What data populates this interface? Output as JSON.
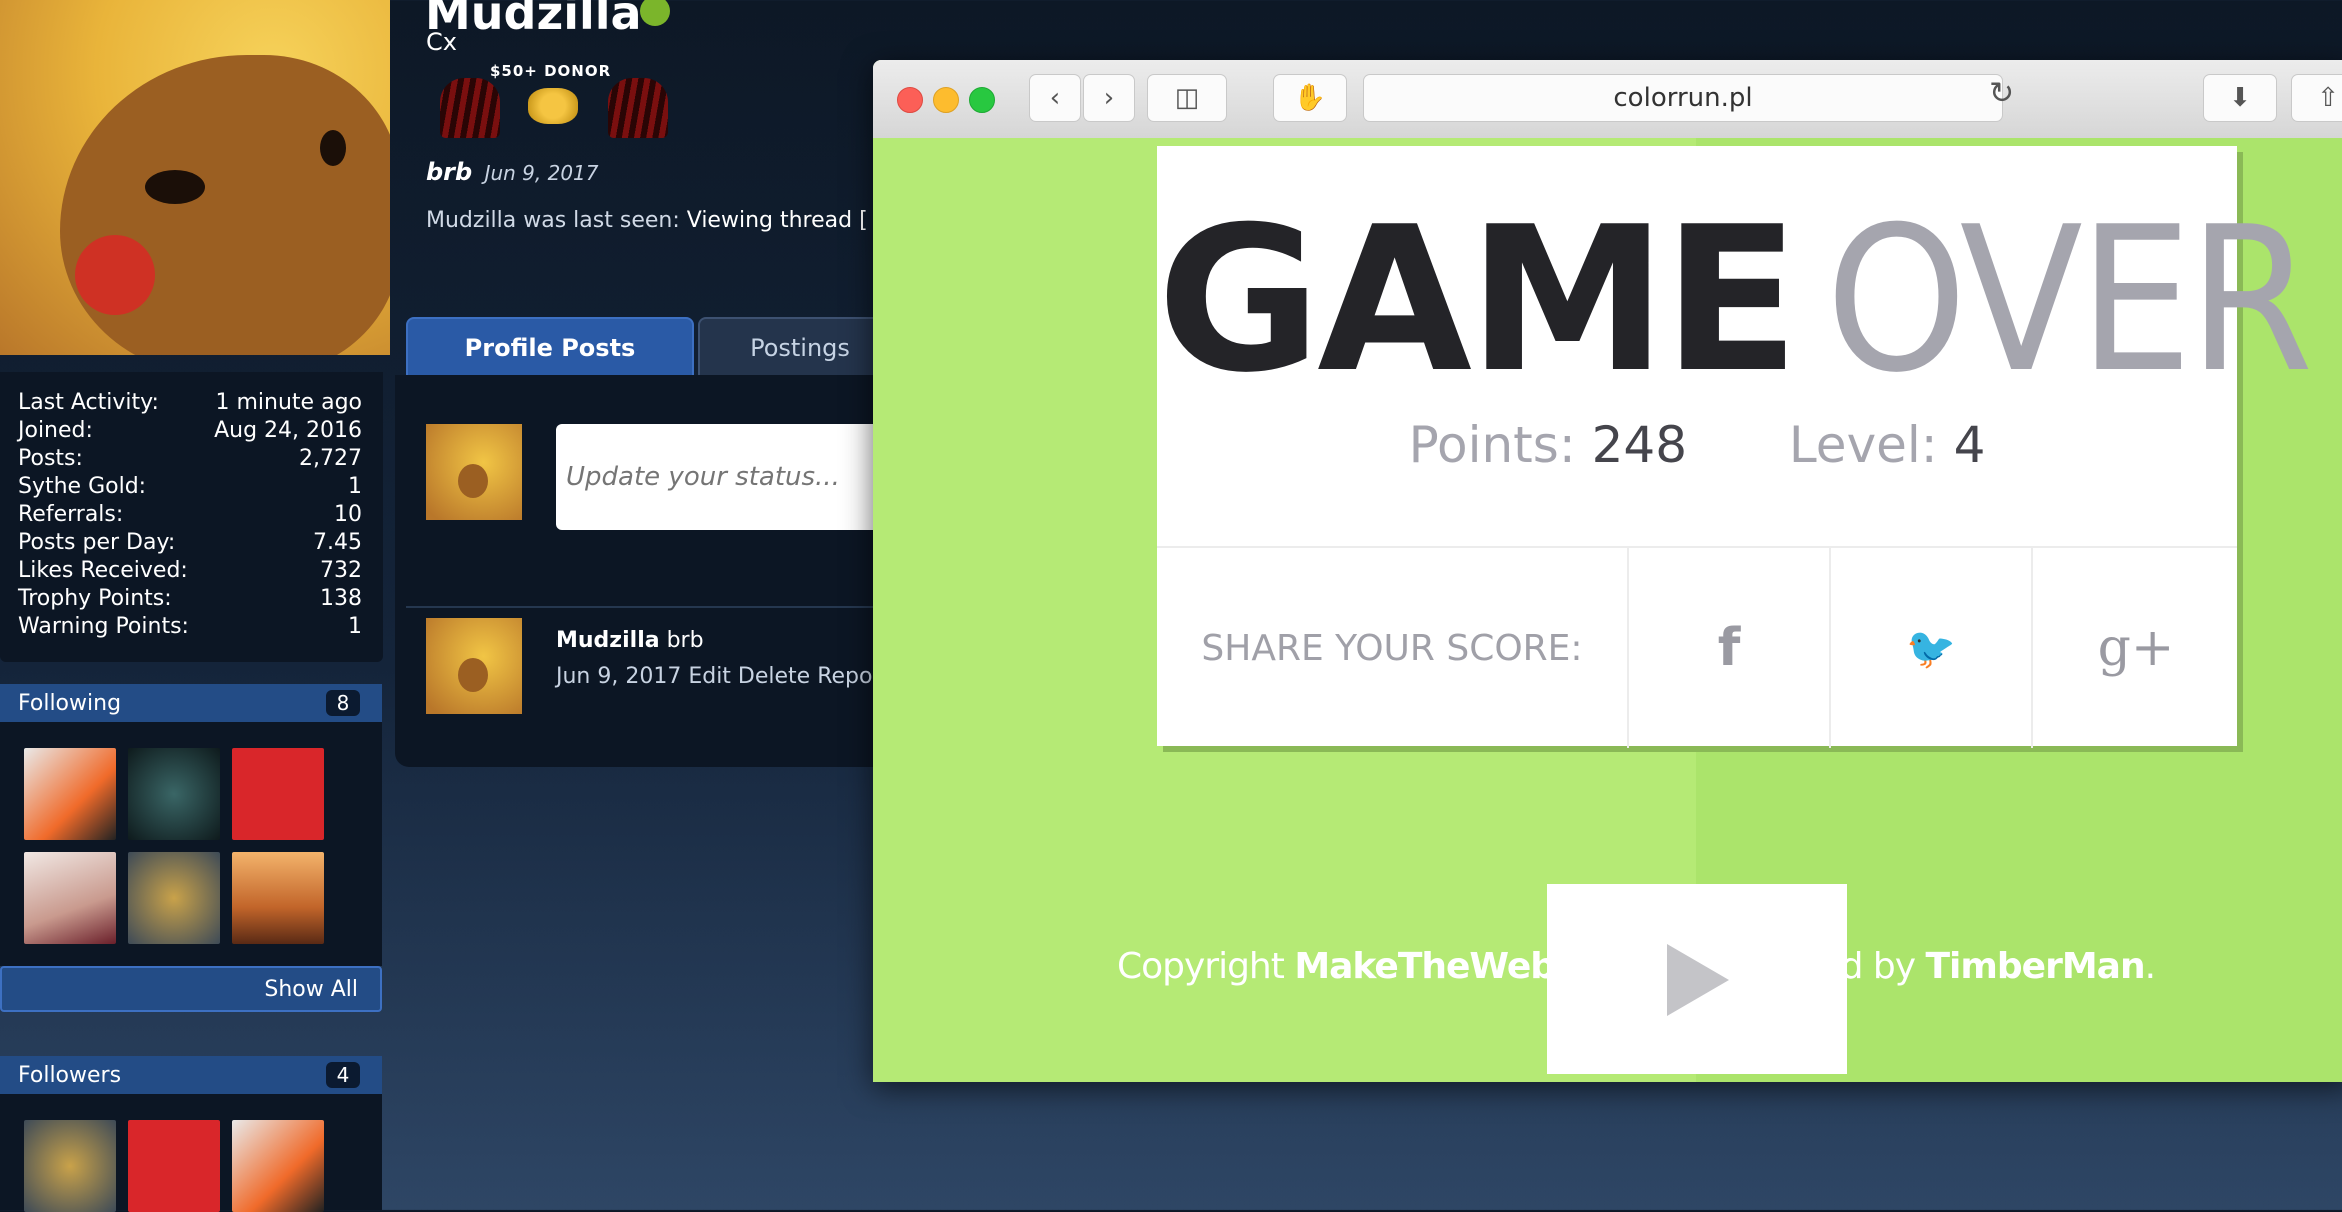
{
  "profile": {
    "username": "Mudzilla",
    "user_title": "Cx",
    "donor_badge": "$50+ DONOR",
    "status": "brb",
    "status_date": "Jun 9, 2017",
    "last_seen_label": "Mudzilla was last seen:",
    "last_seen_value": "Viewing thread [",
    "tabs": [
      "Profile Posts",
      "Postings"
    ],
    "stats": [
      {
        "label": "Last Activity:",
        "value": "1 minute ago"
      },
      {
        "label": "Joined:",
        "value": "Aug 24, 2016"
      },
      {
        "label": "Posts:",
        "value": "2,727"
      },
      {
        "label": "Sythe Gold:",
        "value": "1"
      },
      {
        "label": "Referrals:",
        "value": "10"
      },
      {
        "label": "Posts per Day:",
        "value": "7.45"
      },
      {
        "label": "Likes Received:",
        "value": "732"
      },
      {
        "label": "Trophy Points:",
        "value": "138"
      },
      {
        "label": "Warning Points:",
        "value": "1"
      }
    ],
    "following": {
      "title": "Following",
      "count": "8",
      "show_all": "Show All"
    },
    "followers": {
      "title": "Followers",
      "count": "4"
    },
    "status_placeholder": "Update your status...",
    "post": {
      "author": "Mudzilla",
      "text": "brb",
      "meta": "Jun 9, 2017 Edit Delete Repo"
    }
  },
  "browser": {
    "url": "colorrun.pl",
    "colors": {
      "background": "#b5ea75",
      "card": "#ffffff"
    }
  },
  "game": {
    "title_bold": "GAME",
    "title_light": "OVER",
    "points_label": "Points:",
    "points": "248",
    "level_label": "Level:",
    "level": "4",
    "share_label": "SHARE YOUR SCORE:",
    "share_buttons": [
      {
        "icon": "facebook-icon",
        "glyph": "f"
      },
      {
        "icon": "twitter-icon",
        "glyph": "🐦"
      },
      {
        "icon": "google-plus-icon",
        "glyph": "g+"
      }
    ],
    "footer": {
      "copyright_label": "Copyright",
      "copyright_name": "MakeTheWeb",
      "inspired_label": "Inspired by",
      "inspired_name": "TimberMan"
    }
  }
}
